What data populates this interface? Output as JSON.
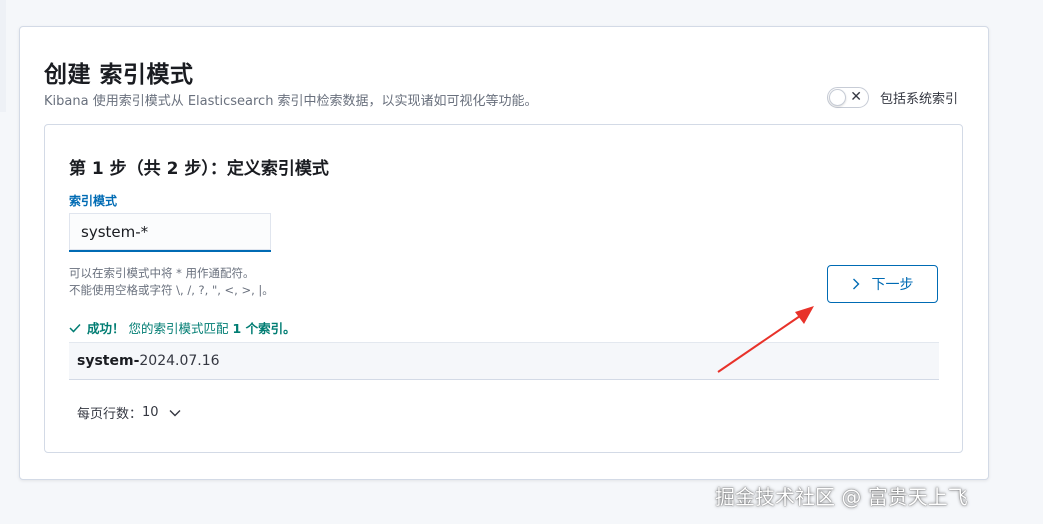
{
  "header": {
    "title": "创建 索引模式",
    "subtitle": "Kibana 使用索引模式从 Elasticsearch 索引中检索数据，以实现诸如可视化等功能。",
    "toggle_label": "包括系统索引",
    "toggle_on": false
  },
  "step": {
    "title": "第 1 步（共 2 步）：定义索引模式",
    "field_label": "索引模式",
    "input_value": "system-*",
    "help_line1": "可以在索引模式中将 * 用作通配符。",
    "help_line2": "不能使用空格或字符 \\, /, ?, \", <, >, |。",
    "next_button": "下一步",
    "success_prefix": "成功！",
    "success_text": "您的索引模式匹配",
    "success_count": "1 个索引。",
    "result_match": "system-",
    "result_rest": "2024.07.16",
    "rows_per_page_label": "每页行数：",
    "rows_per_page_value": "10"
  },
  "icons": {
    "toggle": "cross-icon",
    "next": "chevron-right-icon",
    "success": "check-icon",
    "rows": "chevron-down-icon"
  },
  "colors": {
    "primary": "#006bb4",
    "success": "#017d73",
    "annotation_arrow": "#e8322a"
  },
  "watermark": "掘金技术社区 @ 富贵天上飞"
}
